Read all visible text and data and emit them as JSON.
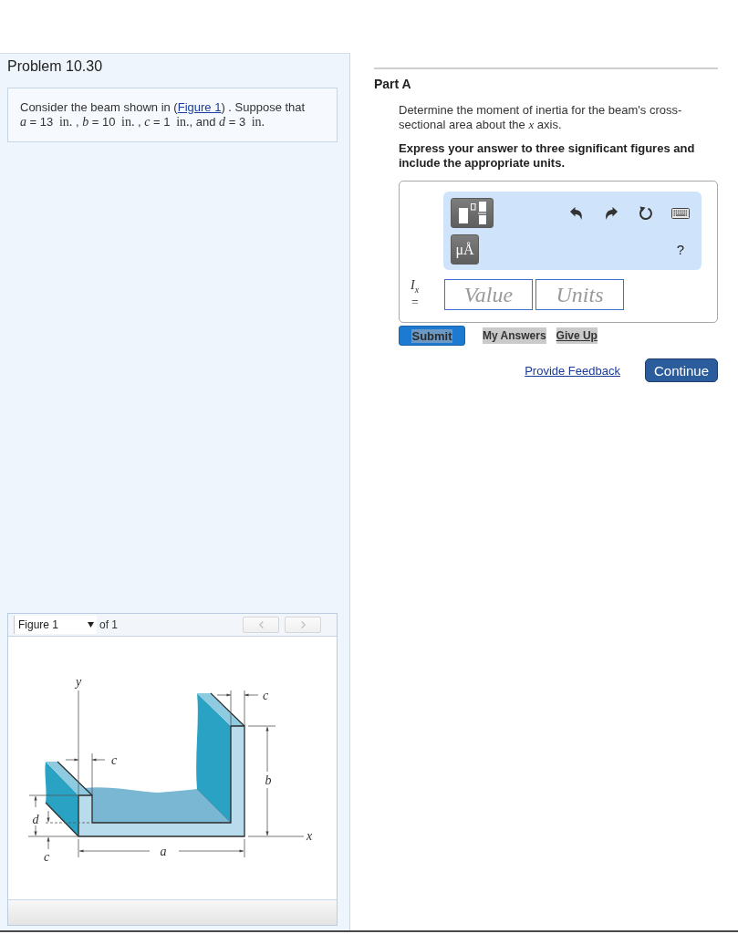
{
  "problem": {
    "title": "Problem 10.30",
    "statement": [
      {
        "kind": "text",
        "text": "Consider the beam shown in ("
      },
      {
        "kind": "link",
        "text": "Figure 1"
      },
      {
        "kind": "text",
        "text": ") . Suppose that "
      },
      {
        "kind": "var",
        "text": "a"
      },
      {
        "kind": "text",
        "text": " = 13 "
      },
      {
        "kind": "unit",
        "text": "in."
      },
      {
        "kind": "text",
        "text": " , "
      },
      {
        "kind": "var",
        "text": "b"
      },
      {
        "kind": "text",
        "text": " = 10 "
      },
      {
        "kind": "unit",
        "text": "in."
      },
      {
        "kind": "text",
        "text": " , "
      },
      {
        "kind": "var",
        "text": "c"
      },
      {
        "kind": "text",
        "text": " = 1 "
      },
      {
        "kind": "unit",
        "text": "in."
      },
      {
        "kind": "text",
        "text": ", and "
      },
      {
        "kind": "var",
        "text": "d"
      },
      {
        "kind": "text",
        "text": " = 3 "
      },
      {
        "kind": "unit",
        "text": "in."
      }
    ]
  },
  "figure": {
    "selector": "Figure 1",
    "count": "of 1",
    "nav": [
      {
        "kind": "prev",
        "disabled": true
      },
      {
        "kind": "next",
        "disabled": true
      }
    ],
    "labels": {
      "axis_y": "y",
      "dim_c": [
        "c",
        "c",
        "c"
      ],
      "dim_b": "b",
      "dim_d": "d",
      "dim_a": "a",
      "axis_x": "x"
    }
  },
  "part": {
    "title": "Part A",
    "question": [
      {
        "kind": "text",
        "text": "Determine the moment of inertia for the beam's cross-sectional area about the "
      },
      {
        "kind": "var",
        "text": "x"
      },
      {
        "kind": "text",
        "text": " axis."
      }
    ],
    "instruction": "Express your answer to three significant figures and include the appropriate units.",
    "answer": {
      "toolbar": {
        "buttons": [
          {
            "kind": "templates"
          },
          {
            "kind": "units",
            "text": "μÅ"
          }
        ],
        "actions": [
          {
            "kind": "undo"
          },
          {
            "kind": "redo"
          },
          {
            "kind": "reset"
          },
          {
            "kind": "keyboard"
          }
        ],
        "help": "?"
      },
      "label": "I$_{x}$ =",
      "fields": [
        {
          "placeholder": "Value"
        },
        {
          "placeholder": "Units"
        }
      ]
    },
    "buttons": [
      {
        "kind": "submit",
        "label": "Submit",
        "highlighted": true
      },
      {
        "kind": "answers",
        "label": "My Answers",
        "highlighted": false
      },
      {
        "kind": "give_up",
        "label": "Give Up",
        "highlighted": false
      }
    ],
    "feedback_link": "Provide Feedback",
    "continue_button": "Continue"
  }
}
